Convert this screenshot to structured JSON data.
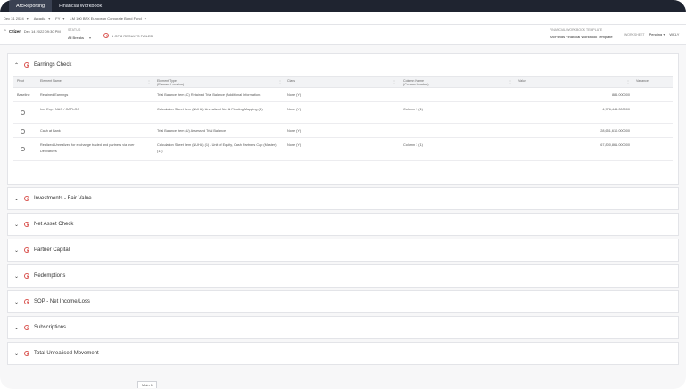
{
  "app": {
    "tabs": [
      {
        "label": "ArcReporting"
      },
      {
        "label": "Financial Workbook"
      }
    ]
  },
  "filters": {
    "date": "Dec 31 2024",
    "scope": "Arcadia",
    "period": "FY",
    "fund": "LM 100 BFX European Corporate Bond Fund"
  },
  "status": {
    "user": "Citizen",
    "timestamp": "Dec 14 2022 09:30 PM",
    "status_label": "STATUS",
    "status_value": "All Breaks",
    "fails_text": "1 OF 8 RESULTS FAILED",
    "template_label": "FINANCIAL WORKBOOK TEMPLATE",
    "template_value": "ArcFunds Financial Workbook Template",
    "worksheet_label": "WORKSHEET",
    "worksheet_value": "Pending",
    "more_label": "WKLY"
  },
  "earnings_check": {
    "title": "Earnings Check",
    "columns": [
      {
        "label": "Pivot"
      },
      {
        "label": "Element Name"
      },
      {
        "label": "Element Type",
        "label2": "(Element Location)"
      },
      {
        "label": "Class"
      },
      {
        "label": "Column Name",
        "label2": "(Column Number)"
      },
      {
        "label": "Value"
      },
      {
        "label": "Variance"
      }
    ],
    "rows": [
      {
        "pivot": "Baseline",
        "name": "Retained Earnings",
        "type": "Trial Balance Item (C) Retained Trial Balance (Additional Information)",
        "class": "None (Y)",
        "column": "",
        "value": "886.000000"
      },
      {
        "pivot": "",
        "name": "Inc. Exp / NUG / CAPLOC",
        "type": "Calculation Sheet Item (NUHA) Unrealized Net & Floating Mapping (B)",
        "class": "None (Y)",
        "column": "Column 1 (1)",
        "value": "4,776,446.000000"
      },
      {
        "pivot": "",
        "name": "Cash at Bank",
        "type": "Trial Balance Item (U) Assessed Trial Balance",
        "class": "None (Y)",
        "column": "",
        "value": "28,651,610.000000"
      },
      {
        "pivot": "",
        "name": "Realized/Unrealized for exchange traded and partners via over Derivatives",
        "type": "Calculation Sheet Item (NUHA) (1) - Unit of Equity, Cash Partners Cap (Master) (11)",
        "class": "None (Y)",
        "column": "Column 1 (1)",
        "value": "67,800,861.000000"
      }
    ]
  },
  "sections": [
    {
      "title": "Investments - Fair Value"
    },
    {
      "title": "Net Asset Check"
    },
    {
      "title": "Partner Capital"
    },
    {
      "title": "Redemptions"
    },
    {
      "title": "SOP - Net Income/Loss"
    },
    {
      "title": "Subscriptions"
    },
    {
      "title": "Total Unrealised Movement"
    }
  ],
  "footer": {
    "sheet_tab": "Main 1"
  },
  "colors": {
    "topbar": "#1f2430",
    "fail": "#d9534f",
    "panel_bg": "#ffffff"
  }
}
